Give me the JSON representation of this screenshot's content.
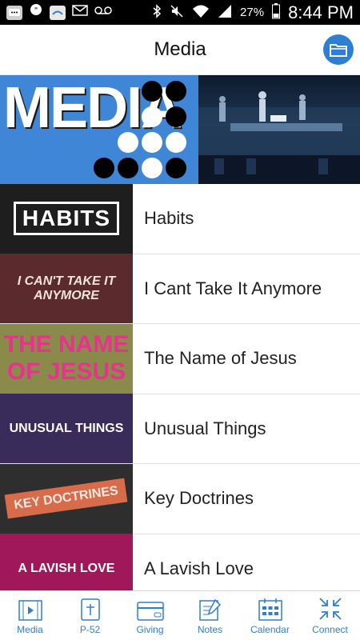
{
  "status_bar": {
    "battery": "27%",
    "time": "8:44 PM",
    "icons": [
      "message-icon",
      "hangouts-icon",
      "grace-app-icon",
      "email-icon",
      "voicemail-icon",
      "bluetooth-icon",
      "mute-icon",
      "wifi-icon",
      "signal-icon",
      "battery-icon"
    ]
  },
  "header": {
    "title": "Media",
    "action_icon": "folder-icon"
  },
  "banner": {
    "word": "MEDIA"
  },
  "series": [
    {
      "title": "Habits",
      "thumb_text": "HABITS",
      "thumb_bg": "#1e1e1e",
      "thumb_color": "#ffffff"
    },
    {
      "title": "I Cant Take It Anymore",
      "thumb_text": "I CAN'T TAKE IT ANYMORE",
      "thumb_bg": "#5a2a2c",
      "thumb_color": "#f1e5d8"
    },
    {
      "title": "The Name of Jesus",
      "thumb_text": "THE NAME OF JESUS",
      "thumb_bg": "#8a8a4a",
      "thumb_color": "#e8338e"
    },
    {
      "title": "Unusual Things",
      "thumb_text": "UNUSUAL THINGS",
      "thumb_bg": "#3a2c5a",
      "thumb_color": "#ffffff"
    },
    {
      "title": "Key Doctrines",
      "thumb_text": "KEY DOCTRINES",
      "thumb_bg": "#2e2e2e",
      "thumb_color": "#d86b4a"
    },
    {
      "title": "A Lavish Love",
      "thumb_text": "A LAVISH LOVE",
      "thumb_bg": "#a0185a",
      "thumb_color": "#ffffff"
    }
  ],
  "tabs": [
    {
      "label": "Media",
      "icon": "film-icon"
    },
    {
      "label": "P-52",
      "icon": "bible-icon"
    },
    {
      "label": "Giving",
      "icon": "credit-card-icon"
    },
    {
      "label": "Notes",
      "icon": "notes-icon"
    },
    {
      "label": "Calendar",
      "icon": "calendar-icon"
    },
    {
      "label": "Connect",
      "icon": "connect-arrows-icon"
    }
  ],
  "colors": {
    "accent": "#2e7fd1",
    "banner_blue": "#3f86d6"
  }
}
